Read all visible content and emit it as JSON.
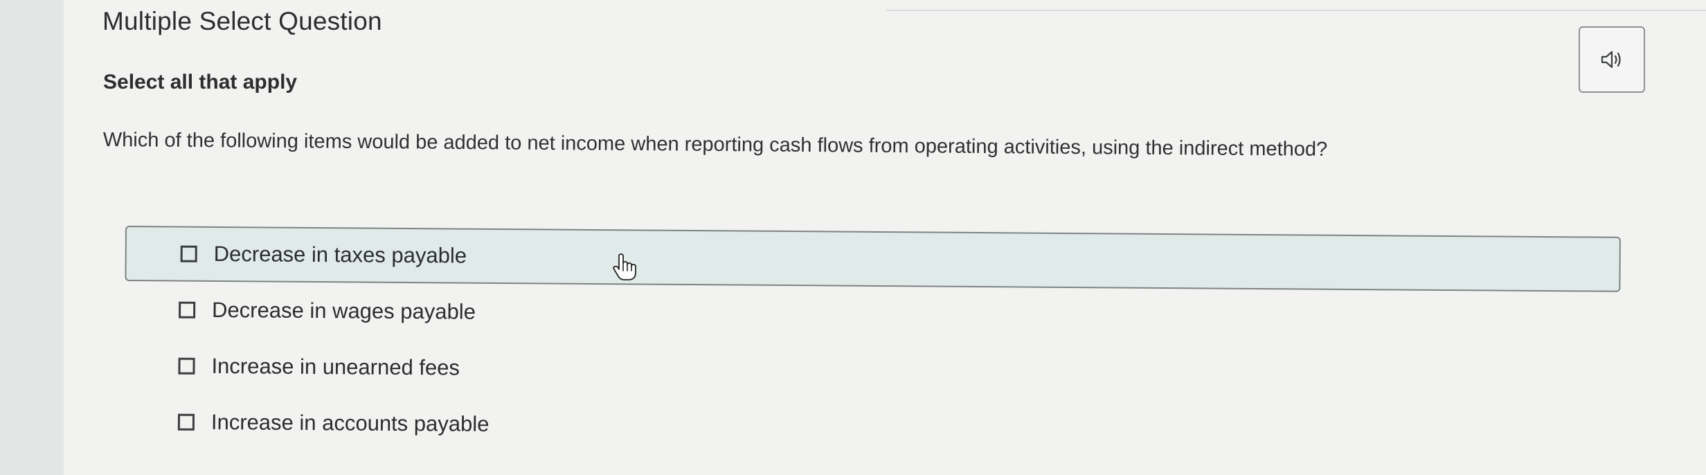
{
  "question": {
    "type_label": "Multiple Select Question",
    "instruction": "Select all that apply",
    "prompt": "Which of the following items would be added to net income when reporting cash flows from operating activities, using the indirect method?"
  },
  "audio_button": {
    "icon": "speaker-icon"
  },
  "options": [
    {
      "label": "Decrease in taxes payable",
      "checked": false,
      "hovered": true
    },
    {
      "label": "Decrease in wages payable",
      "checked": false,
      "hovered": false
    },
    {
      "label": "Increase in unearned fees",
      "checked": false,
      "hovered": false
    },
    {
      "label": "Increase in accounts payable",
      "checked": false,
      "hovered": false
    }
  ],
  "cursor": {
    "icon": "hand-pointer-icon"
  },
  "colors": {
    "page_background": "#f2f2f1",
    "hover_row": "#e0ebe9",
    "text": "#2b2d2e"
  }
}
